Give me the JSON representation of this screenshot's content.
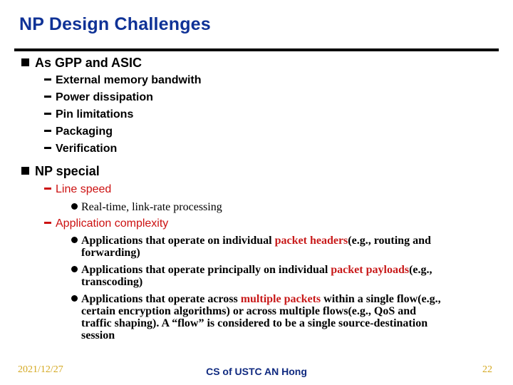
{
  "slide": {
    "title": "NP Design Challenges",
    "sections": [
      {
        "heading": "As GPP and ASIC",
        "items": [
          "External memory bandwith",
          "Power dissipation",
          "Pin limitations",
          "Packaging",
          "Verification"
        ]
      },
      {
        "heading": "NP special",
        "items": [
          {
            "label": "Line speed",
            "subitems": [
              "Real-time, link-rate processing"
            ]
          },
          {
            "label": "Application complexity",
            "subitems": [
              {
                "pre": "Applications that operate on individual ",
                "highlight": "packet headers",
                "post_line1": "(e.g., routing and",
                "post_line2": "forwarding)"
              },
              {
                "pre": "Applications that operate principally on individual ",
                "highlight": "packet payloads",
                "post_line1": "(e.g.,",
                "post_line2": "transcoding)"
              },
              {
                "pre": "Applications that operate across ",
                "highlight": "multiple packets",
                "post_line1": " within a single flow(e.g.,",
                "line2": "certain encryption algorithms) or across multiple flows(e.g., QoS and",
                "line3": "traffic shaping). A “flow” is considered to be a single source-destination",
                "line4": "session"
              }
            ]
          }
        ]
      }
    ]
  },
  "footer": {
    "date": "2021/12/27",
    "center": "CS of USTC AN Hong",
    "page": "22"
  },
  "colors": {
    "title": "#0f3296",
    "highlight": "#c81a1a",
    "footer_side": "#d4a820",
    "footer_center": "#102a80"
  }
}
